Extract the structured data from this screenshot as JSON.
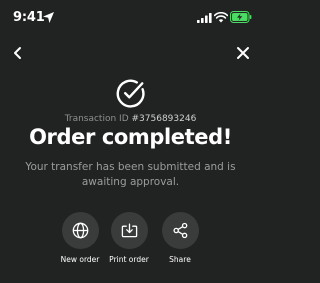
{
  "status_bar": {
    "time": "9:41",
    "icons": [
      "location-arrow-icon",
      "signal-icon",
      "wifi-icon",
      "battery-charging-icon"
    ],
    "battery_color": "#4cd964"
  },
  "nav": {
    "back_icon": "chevron-left-icon",
    "close_icon": "close-icon"
  },
  "confirmation": {
    "icon": "check-circle-icon",
    "transaction_label": "Transaction ID",
    "transaction_id": "#3756893246",
    "title": "Order completed!",
    "message": "Your transfer has been submitted and is awaiting approval."
  },
  "actions": [
    {
      "label": "New order",
      "icon": "globe-icon"
    },
    {
      "label": "Print order",
      "icon": "print-download-icon"
    },
    {
      "label": "Share",
      "icon": "share-icon"
    }
  ],
  "colors": {
    "background": "#212322",
    "action_button": "#3a3c3b",
    "text_primary": "#ffffff",
    "text_secondary": "#9a9d9b"
  }
}
